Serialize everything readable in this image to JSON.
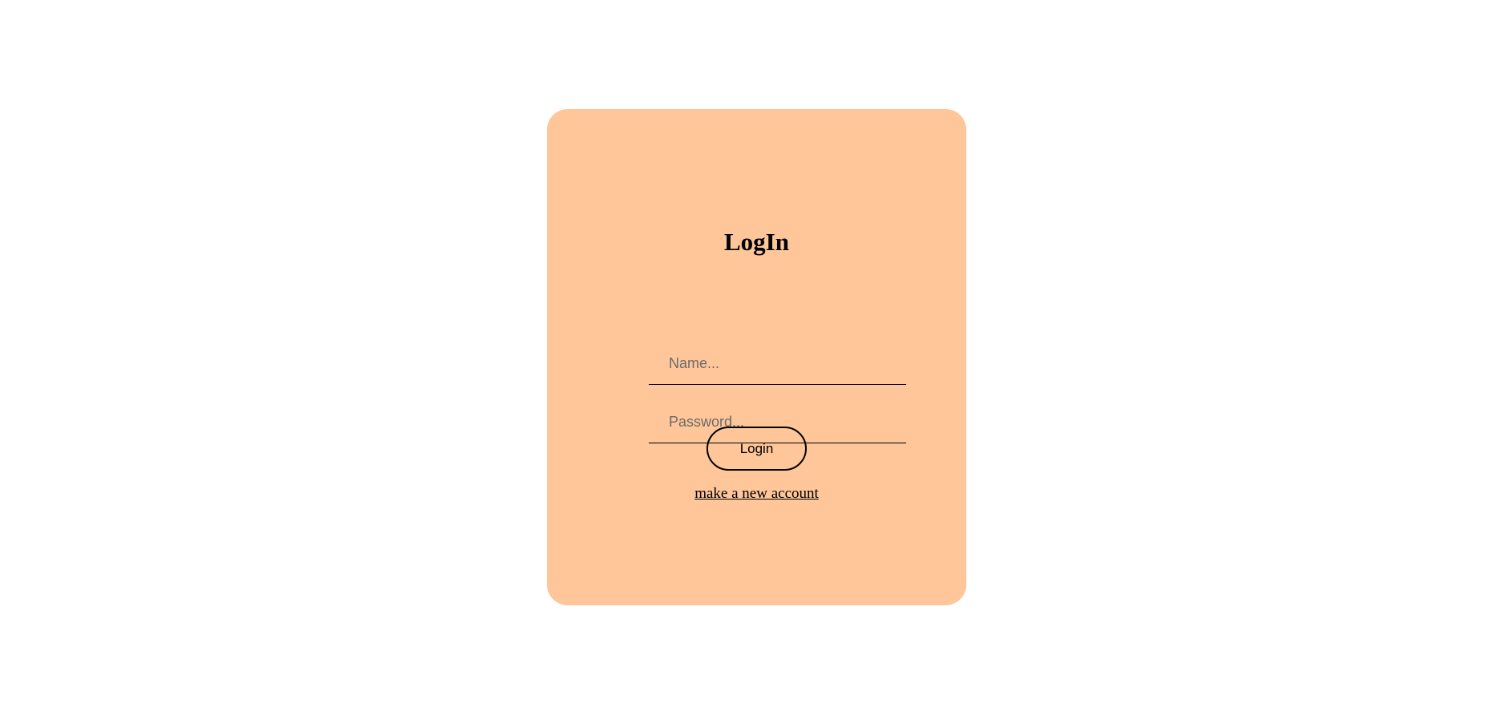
{
  "login_card": {
    "title": "LogIn",
    "name_field": {
      "value": "",
      "placeholder": "Name..."
    },
    "password_field": {
      "value": "",
      "placeholder": "Password..."
    },
    "login_button_label": "Login",
    "new_account_link": "make a new account"
  },
  "colors": {
    "card_background": "#fec699",
    "page_background": "#ffffff",
    "text": "#000000",
    "placeholder": "#6b6b6b"
  }
}
